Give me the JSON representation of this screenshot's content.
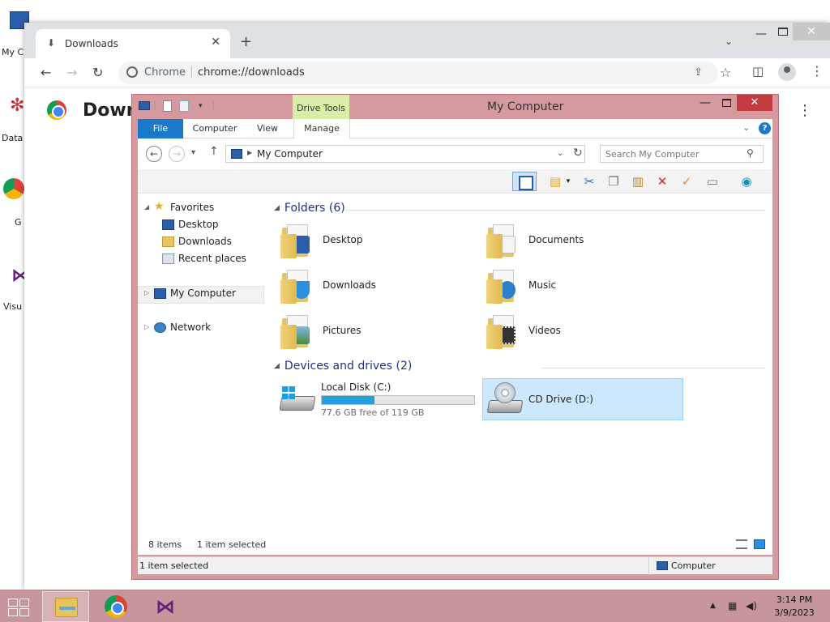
{
  "desktop": {
    "icons": [
      {
        "label": "My C"
      },
      {
        "label": "Data"
      },
      {
        "label": "G"
      },
      {
        "label": "Visu"
      }
    ]
  },
  "chrome": {
    "tab_title": "Downloads",
    "address_site": "Chrome",
    "address_url": "chrome://downloads",
    "page_title": "Down"
  },
  "explorer": {
    "title": "My Computer",
    "contextual_tab": "Drive Tools",
    "ribbon_tabs": [
      {
        "label": "File"
      },
      {
        "label": "Computer"
      },
      {
        "label": "View"
      },
      {
        "label": "Manage"
      }
    ],
    "address_path": "My Computer",
    "search_placeholder": "Search My Computer",
    "nav": {
      "favorites": "Favorites",
      "favorites_items": [
        {
          "label": "Desktop"
        },
        {
          "label": "Downloads"
        },
        {
          "label": "Recent places"
        }
      ],
      "my_computer": "My Computer",
      "network": "Network"
    },
    "folders_header": "Folders (6)",
    "folders": [
      {
        "name": "Desktop"
      },
      {
        "name": "Documents"
      },
      {
        "name": "Downloads"
      },
      {
        "name": "Music"
      },
      {
        "name": "Pictures"
      },
      {
        "name": "Videos"
      }
    ],
    "devices_header": "Devices and drives (2)",
    "drives": [
      {
        "name": "Local Disk (C:)",
        "free": "77.6 GB free of 119 GB",
        "used_fraction": 0.348
      },
      {
        "name": "CD Drive (D:)"
      }
    ],
    "status": {
      "items": "8 items",
      "selected": "1 item selected",
      "bottom_left": "1 item selected",
      "bottom_right": "Computer"
    }
  },
  "taskbar": {
    "time": "3:14 PM",
    "date": "3/9/2023"
  },
  "colors": {
    "window_border": "#d49aa0",
    "taskbar": "#c7959c",
    "file_tab": "#1979ca",
    "drive_tools": "#d9efa8",
    "selection": "#cce8ff",
    "progress": "#26a0da"
  }
}
